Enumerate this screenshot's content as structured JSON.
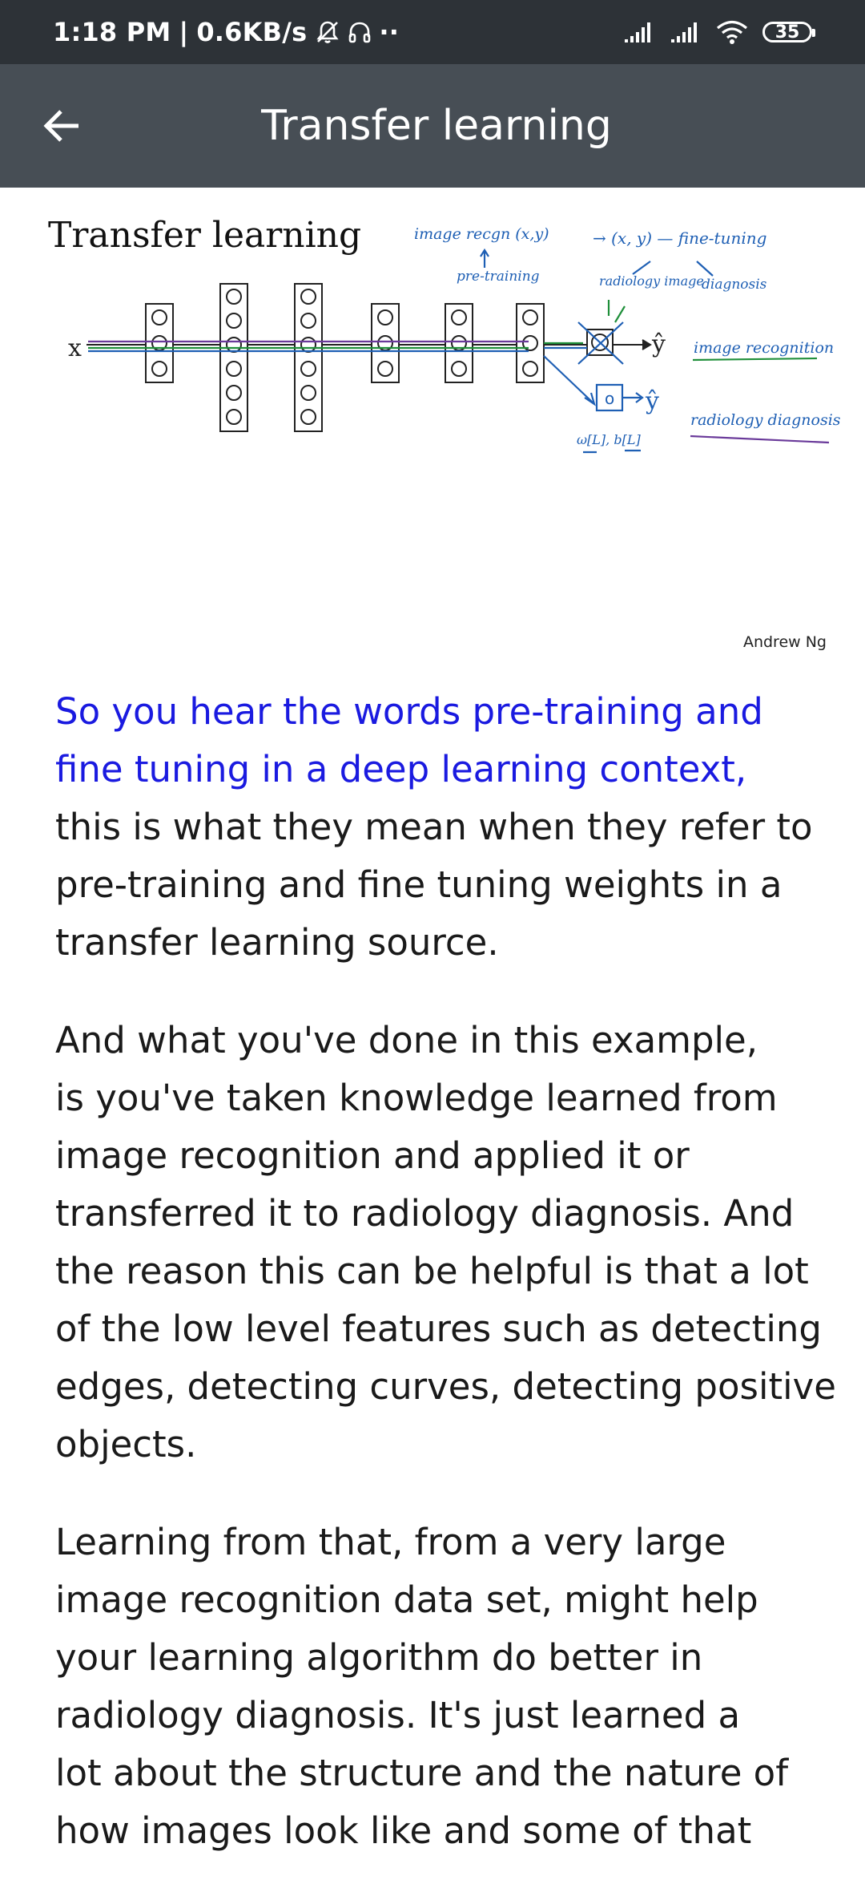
{
  "status_bar": {
    "time": "1:18 PM",
    "separator": "|",
    "speed": "0.6KB/s",
    "dots": "··",
    "battery": "35"
  },
  "toolbar": {
    "title": "Transfer learning"
  },
  "slide": {
    "title": "Transfer learning",
    "credit": "Andrew Ng",
    "input_label": "x",
    "output_label": "ŷ",
    "output2_label": "ŷ",
    "node_label": "o",
    "annotations": {
      "image_recog_pair": "image recgn (x,y)",
      "pre_training": "pre-training",
      "xy": "→ (x, y) — fine-tuning",
      "radiology": "radiology image",
      "diagnosis": "diagnosis",
      "image_recognition": "image recognition",
      "radiology_diagnosis": "radiology diagnosis",
      "weights": "ω[L], b[L]"
    },
    "colors": {
      "network": "#222222",
      "blue_ink": "#1e5fb4",
      "green_ink": "#1f8f3a",
      "purple_ink": "#6a3a9a"
    }
  },
  "transcript": {
    "p1_highlight": [
      "So you hear the words pre-training and",
      "fine tuning in a deep learning context,"
    ],
    "p1_rest": [
      "this is what they mean when they refer to",
      "pre-training and fine tuning weights in a",
      "transfer learning source."
    ],
    "p2": [
      "And what you've done in this example,",
      "is you've taken knowledge learned from",
      "image recognition and applied it or",
      "transferred it to radiology diagnosis. And",
      "the reason this can be helpful is that a lot",
      "of the low level features such as detecting",
      "edges, detecting curves, detecting positive",
      "objects."
    ],
    "p3": [
      "Learning from that, from a very large",
      "image recognition data set, might help",
      "your learning algorithm do better in",
      "radiology diagnosis. It's just learned a",
      "lot about the structure and the nature of",
      "how images look like and some of that"
    ]
  }
}
